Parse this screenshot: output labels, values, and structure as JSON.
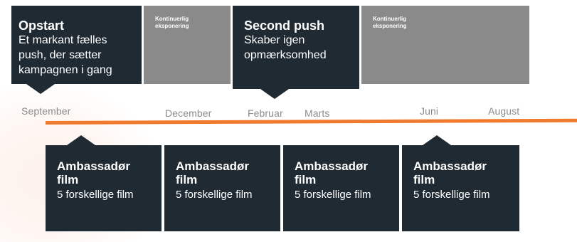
{
  "top_boxes": {
    "opstart": {
      "title": "Opstart",
      "text": "Et markant fælles push, der sætter kampagnen i gang"
    },
    "kont1": {
      "label": "Kontinuerlig\neksponering"
    },
    "second": {
      "title": "Second push",
      "text": "Skaber igen opmærksomhed"
    },
    "kont2": {
      "label": "Kontinuerlig\neksponering"
    }
  },
  "months": [
    "September",
    "December",
    "Februar",
    "Marts",
    "Juni",
    "August"
  ],
  "films": [
    {
      "title": "Ambassadør\nfilm",
      "subtitle": "5 forskellige film"
    },
    {
      "title": "Ambassadør\nfilm",
      "subtitle": "5 forskellige film"
    },
    {
      "title": "Ambassadør\nfilm",
      "subtitle": "5 forskellige film"
    },
    {
      "title": "Ambassadør\nfilm",
      "subtitle": "5 forskellige film"
    }
  ],
  "colors": {
    "dark": "#1f2a33",
    "grey": "#8a8a8a",
    "timeline": "#f07a2e",
    "month_text": "#8c8c8c"
  }
}
